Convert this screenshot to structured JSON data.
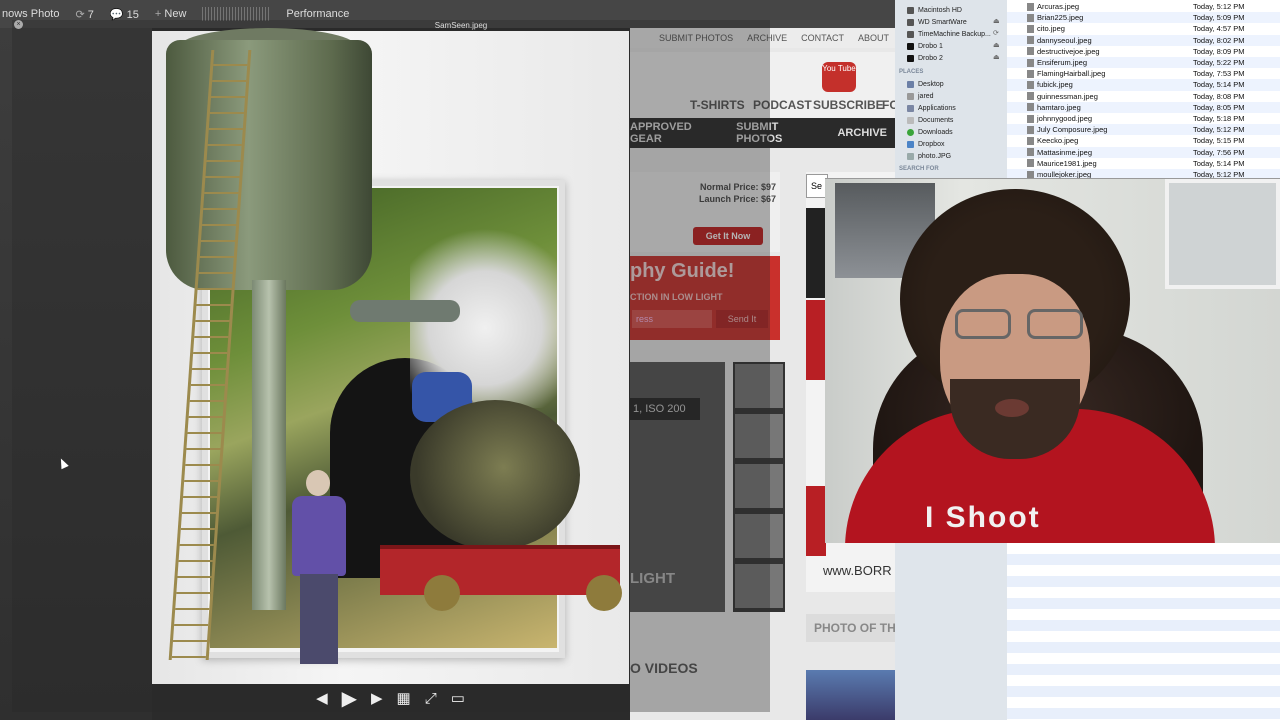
{
  "adminbar": {
    "site_title": "nows Photo",
    "updates_count": "7",
    "comments_count": "15",
    "new_label": "New",
    "performance_label": "Performance"
  },
  "viewer": {
    "filename": "SamSeen.jpeg"
  },
  "website": {
    "nav": [
      "SUBMIT PHOTOS",
      "ARCHIVE",
      "CONTACT",
      "ABOUT"
    ],
    "icon_labels": [
      "T-SHIRTS",
      "PODCAST",
      "SUBSCRIBE",
      "FO"
    ],
    "youtube_label": "You Tube",
    "menu": [
      "APPROVED GEAR",
      "SUBMIT PHOTOS",
      "ARCHIVE"
    ],
    "normal_price": "Normal Price: $97",
    "launch_price": "Launch Price: $67",
    "get_it_now": "Get It Now",
    "guide_title": "phy Guide!",
    "guide_sub": "CTION IN LOW LIGHT",
    "guide_input_placeholder": "ress",
    "guide_send": "Send It",
    "gallery_label": "1, ISO 200",
    "light_label": "LIGHT",
    "videos_label": "O VIDEOS",
    "borrow_label": "www.BORR",
    "potd_label": "PHOTO OF THE D",
    "search_placeholder": "Se"
  },
  "finder": {
    "devices": [
      "Macintosh HD",
      "WD SmartWare",
      "TimeMachine Backup...",
      "Drobo 1",
      "Drobo 2"
    ],
    "places_header": "PLACES",
    "places": [
      "Desktop",
      "jared",
      "Applications",
      "Documents",
      "Downloads",
      "Dropbox",
      "photo.JPG"
    ],
    "search_header": "SEARCH FOR",
    "files": [
      {
        "name": "Arcuras.jpeg",
        "date": "Today, 5:12 PM"
      },
      {
        "name": "Brian225.jpeg",
        "date": "Today, 5:09 PM"
      },
      {
        "name": "cito.jpeg",
        "date": "Today, 4:57 PM"
      },
      {
        "name": "dannyseoul.jpeg",
        "date": "Today, 8:02 PM"
      },
      {
        "name": "destructivejoe.jpeg",
        "date": "Today, 8:09 PM"
      },
      {
        "name": "Ensiferum.jpeg",
        "date": "Today, 5:22 PM"
      },
      {
        "name": "FlamingHairball.jpeg",
        "date": "Today, 7:53 PM"
      },
      {
        "name": "fubick.jpeg",
        "date": "Today, 5:14 PM"
      },
      {
        "name": "guinnessman.jpeg",
        "date": "Today, 8:08 PM"
      },
      {
        "name": "hamtaro.jpeg",
        "date": "Today, 8:05 PM"
      },
      {
        "name": "johnnygood.jpeg",
        "date": "Today, 5:18 PM"
      },
      {
        "name": "July Composure.jpeg",
        "date": "Today, 5:12 PM"
      },
      {
        "name": "Keecko.jpeg",
        "date": "Today, 5:15 PM"
      },
      {
        "name": "Mattasinme.jpeg",
        "date": "Today, 7:56 PM"
      },
      {
        "name": "Maurice1981.jpeg",
        "date": "Today, 5:14 PM"
      },
      {
        "name": "moullejoker.jpeg",
        "date": "Today, 5:12 PM"
      }
    ]
  },
  "webcam": {
    "shirt_text": "I Shoot"
  }
}
